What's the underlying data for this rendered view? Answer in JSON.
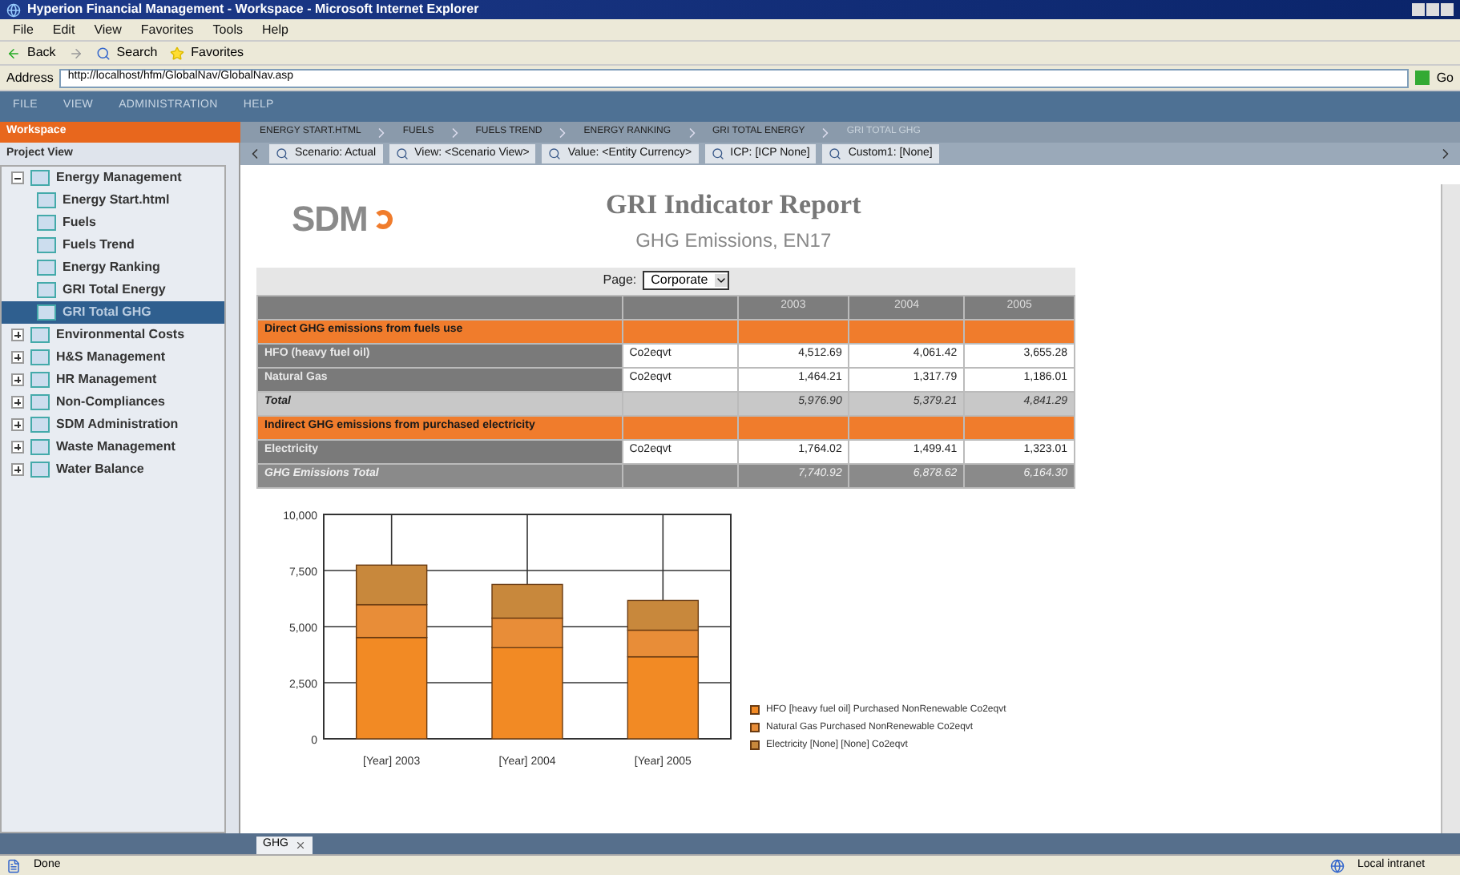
{
  "window": {
    "title": "Hyperion Financial Management - Workspace - Microsoft Internet Explorer"
  },
  "menu": [
    "File",
    "Edit",
    "View",
    "Favorites",
    "Tools",
    "Help"
  ],
  "toolbar": {
    "back": "Back",
    "search": "Search",
    "favorites": "Favorites"
  },
  "address": {
    "label": "Address",
    "url": "http://localhost/hfm/GlobalNav/GlobalNav.asp",
    "go": "Go"
  },
  "app_menu": [
    "FILE",
    "VIEW",
    "ADMINISTRATION",
    "HELP"
  ],
  "workspace_label": "Workspace",
  "breadcrumbs": [
    {
      "label": "ENERGY START.HTML",
      "selected": false
    },
    {
      "label": "FUELS",
      "selected": false
    },
    {
      "label": "FUELS TREND",
      "selected": false
    },
    {
      "label": "ENERGY RANKING",
      "selected": false
    },
    {
      "label": "GRI TOTAL ENERGY",
      "selected": false
    },
    {
      "label": "GRI TOTAL GHG",
      "selected": true
    }
  ],
  "sidebar": {
    "title": "Project View",
    "items": [
      {
        "label": "Energy Management",
        "expanded": true,
        "selected": false,
        "children": [
          {
            "label": "Energy Start.html",
            "selected": false
          },
          {
            "label": "Fuels",
            "selected": false
          },
          {
            "label": "Fuels Trend",
            "selected": false
          },
          {
            "label": "Energy Ranking",
            "selected": false
          },
          {
            "label": "GRI Total Energy",
            "selected": false
          },
          {
            "label": "GRI Total GHG",
            "selected": true
          }
        ]
      },
      {
        "label": "Environmental Costs",
        "expanded": false,
        "selected": false
      },
      {
        "label": "H&S Management",
        "expanded": false,
        "selected": false
      },
      {
        "label": "HR Management",
        "expanded": false,
        "selected": false
      },
      {
        "label": "Non-Compliances",
        "expanded": false,
        "selected": false
      },
      {
        "label": "SDM Administration",
        "expanded": false,
        "selected": false
      },
      {
        "label": "Waste Management",
        "expanded": false,
        "selected": false
      },
      {
        "label": "Water Balance",
        "expanded": false,
        "selected": false
      }
    ]
  },
  "pov": [
    "Scenario: Actual",
    "View: <Scenario View>",
    "Value: <Entity Currency>",
    "ICP: [ICP None]",
    "Custom1: [None]"
  ],
  "report": {
    "logo": "SDM",
    "title": "GRI Indicator Report",
    "subtitle": "GHG Emissions, EN17",
    "page_label": "Page:",
    "page_value": "Corporate",
    "columns": [
      "",
      "",
      "2003",
      "2004",
      "2005"
    ],
    "rows": [
      {
        "kind": "section",
        "cells": [
          "Direct GHG emissions from fuels use",
          "",
          "",
          "",
          ""
        ]
      },
      {
        "kind": "item",
        "cells": [
          "HFO (heavy fuel oil)",
          "Co2eqvt",
          "4,512.69",
          "4,061.42",
          "3,655.28"
        ]
      },
      {
        "kind": "item",
        "cells": [
          "Natural Gas",
          "Co2eqvt",
          "1,464.21",
          "1,317.79",
          "1,186.01"
        ]
      },
      {
        "kind": "total",
        "cells": [
          "Total",
          "",
          "5,976.90",
          "5,379.21",
          "4,841.29"
        ]
      },
      {
        "kind": "section",
        "cells": [
          "Indirect GHG emissions from  purchased electricity",
          "",
          "",
          "",
          ""
        ]
      },
      {
        "kind": "item",
        "cells": [
          "Electricity",
          "Co2eqvt",
          "1,764.02",
          "1,499.41",
          "1,323.01"
        ]
      },
      {
        "kind": "grand_total",
        "cells": [
          "GHG Emissions Total",
          "",
          "7,740.92",
          "6,878.62",
          "6,164.30"
        ]
      }
    ],
    "chart_data": {
      "type": "bar",
      "stacked": true,
      "grid": true,
      "categories": [
        "[Year] 2003",
        "[Year] 2004",
        "[Year] 2005"
      ],
      "yticks": [
        {
          "value": 0,
          "label": "0"
        },
        {
          "value": 2500,
          "label": "2,500"
        },
        {
          "value": 5000,
          "label": "5,000"
        },
        {
          "value": 7500,
          "label": "7,500"
        },
        {
          "value": 10000,
          "label": "10,000"
        }
      ],
      "ylim": [
        0,
        10000
      ],
      "series": [
        {
          "name": "HFO [heavy fuel oil] Purchased NonRenewable Co2eqvt",
          "color": "#f28a24",
          "values": [
            4513,
            4061,
            3655
          ]
        },
        {
          "name": "Natural Gas Purchased NonRenewable Co2eqvt",
          "color": "#e88d38",
          "values": [
            1464,
            1318,
            1186
          ]
        },
        {
          "name": "Electricity [None] [None] Co2eqvt",
          "color": "#c8883c",
          "values": [
            1764,
            1499,
            1323
          ]
        }
      ]
    }
  },
  "doc_tabs": [
    {
      "label": "GHG",
      "selected": true
    }
  ],
  "status_bar": {
    "text": "Done",
    "zone": "Local intranet"
  }
}
